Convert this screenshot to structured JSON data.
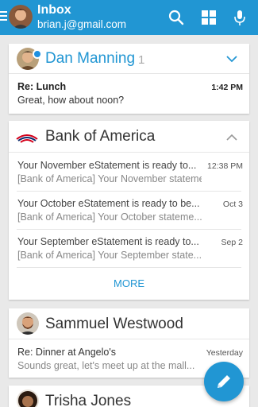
{
  "account": {
    "title": "Inbox",
    "email": "brian.j@gmail.com"
  },
  "icons": {
    "menu": "hamburger-icon",
    "search": "search-icon",
    "grid": "grid-icon",
    "mic": "microphone-icon",
    "compose": "pencil-icon"
  },
  "colors": {
    "accent": "#2196d3",
    "unread_dot": "#1f8fe0",
    "boa_red": "#d4001a",
    "boa_navy": "#0a2a6b"
  },
  "threads": [
    {
      "sender": "Dan Manning",
      "count": "1",
      "expanded": false,
      "messages": [
        {
          "subject": "Re: Lunch",
          "preview": "Great, how about noon?",
          "time": "1:42 PM"
        }
      ]
    },
    {
      "sender": "Bank of America",
      "expanded": true,
      "messages": [
        {
          "subject": "Your November eStatement is ready to...",
          "preview": "[Bank of America] Your November stateme...",
          "time": "12:38 PM"
        },
        {
          "subject": "Your October eStatement is ready to be...",
          "preview": "[Bank of America] Your October stateme...",
          "time": "Oct 3"
        },
        {
          "subject": "Your September eStatement is ready to...",
          "preview": "[Bank of America] Your September state...",
          "time": "Sep 2"
        }
      ],
      "more_label": "MORE"
    },
    {
      "sender": "Sammuel Westwood",
      "messages": [
        {
          "subject": "Re: Dinner at Angelo's",
          "preview": "Sounds great, let's meet up at the mall...",
          "time": "Yesterday"
        }
      ]
    },
    {
      "sender": "Trisha Jones",
      "messages": []
    }
  ]
}
